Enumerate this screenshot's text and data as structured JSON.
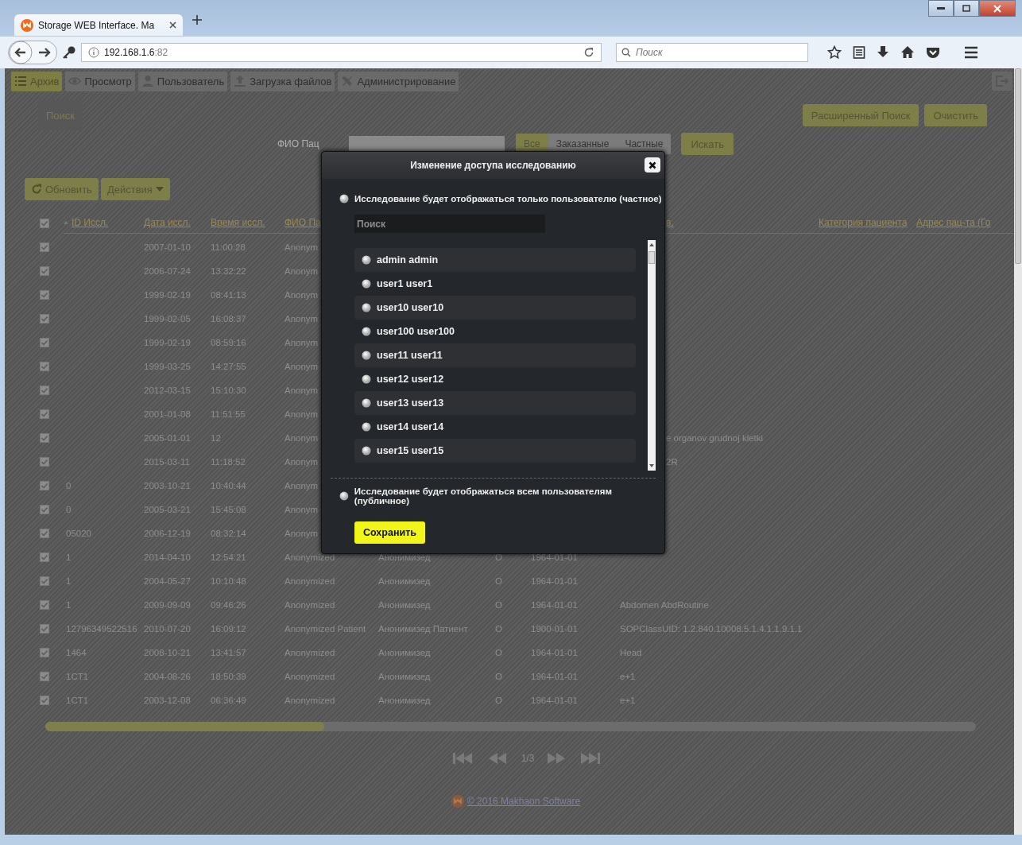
{
  "browser": {
    "tab_title": "Storage WEB Interface. Ma",
    "url_host": "192.168.1.6",
    "url_port": ":82",
    "search_placeholder": "Поиск"
  },
  "nav_tabs": [
    {
      "kind": "archive",
      "label": "Архив",
      "selected": true
    },
    {
      "kind": "view",
      "label": "Просмотр",
      "selected": false
    },
    {
      "kind": "user",
      "label": "Пользователь",
      "selected": false
    },
    {
      "kind": "upload",
      "label": "Загрузка файлов",
      "selected": false
    },
    {
      "kind": "admin",
      "label": "Администрирование",
      "selected": false
    }
  ],
  "search_panel": {
    "tab": "Поиск",
    "buttons": [
      "Расширенный Поиск",
      "Очистить"
    ],
    "filter_label": "ФИО Пац",
    "segments": [
      {
        "label": "Все",
        "selected": true
      },
      {
        "label": "Заказанные",
        "selected": false
      },
      {
        "label": "Частные",
        "selected": false
      }
    ],
    "search_button": "Искать"
  },
  "actions": {
    "refresh": "Обновить",
    "menu": "Действия"
  },
  "table": {
    "all_checked": true,
    "id_sort_ascending": true,
    "columns": {
      "id": "ID Иссл.",
      "date": "Дата иссл.",
      "time": "Время иссл.",
      "name": "ФИО Па",
      "description": "в.",
      "category": "Категория пациента",
      "address": "Адрес пац-та (Го"
    },
    "rows": [
      {
        "checked": true,
        "date": "2007-01-10",
        "time": "11:00:28",
        "name": "Anonym"
      },
      {
        "checked": true,
        "date": "2006-07-24",
        "time": "13:32:22",
        "name": "Anonym"
      },
      {
        "checked": true,
        "date": "1999-02-19",
        "time": "08:41:13",
        "name": "Anonym"
      },
      {
        "checked": true,
        "date": "1999-02-05",
        "time": "16:08:37",
        "name": "Anonym"
      },
      {
        "checked": true,
        "date": "1999-02-19",
        "time": "08:59:16",
        "name": "Anonym"
      },
      {
        "checked": true,
        "date": "1999-03-25",
        "time": "14:27:55",
        "name": "Anonym"
      },
      {
        "checked": true,
        "date": "2012-03-15",
        "time": "15:10:30",
        "name": "Anonym"
      },
      {
        "checked": true,
        "date": "2001-01-08",
        "time": "11:51:55",
        "name": "Anonym"
      },
      {
        "checked": true,
        "date": "2005-01-01",
        "time": "12",
        "name": "Anonym",
        "description": "e organov grudnoj kletki",
        "description_partly_hidden": true
      },
      {
        "checked": true,
        "date": "2015-03-11",
        "time": "11:18:52",
        "name": "Anonym",
        "description": "2R",
        "description_partly_hidden": true
      },
      {
        "checked": true,
        "id": "0",
        "date": "2003-10-21",
        "time": "10:40:44",
        "name": "Anonym"
      },
      {
        "checked": true,
        "id": "0",
        "date": "2005-03-21",
        "time": "15:45:08",
        "name": "Anonym"
      },
      {
        "checked": true,
        "id": "05020",
        "date": "2006-12-19",
        "time": "08:32:14",
        "name": "Anonym"
      },
      {
        "checked": true,
        "id": "1",
        "date": "2014-04-10",
        "time": "12:54:21",
        "name": "Anonymized",
        "name_ru": "Анонимизед",
        "sex": "O",
        "birth": "1964-01-01"
      },
      {
        "checked": true,
        "id": "1",
        "date": "2004-05-27",
        "time": "10:10:48",
        "name": "Anonymized",
        "name_ru": "Анонимизед",
        "sex": "O",
        "birth": "1964-01-01"
      },
      {
        "checked": true,
        "id": "1",
        "date": "2009-09-09",
        "time": "09:46:26",
        "name": "Anonymized",
        "name_ru": "Анонимизед",
        "sex": "O",
        "birth": "1964-01-01",
        "description": "Abdomen AbdRoutine"
      },
      {
        "checked": true,
        "id": "12796349522516",
        "date": "2010-07-20",
        "time": "16:09:12",
        "name": "Anonymized Patient",
        "name_ru": "Анонимизед Патиент",
        "sex": "O",
        "birth": "1900-01-01",
        "description": "SOPClassUID: 1.2.840.10008.5.1.4.1.1.9.1.1"
      },
      {
        "checked": true,
        "id": "1464",
        "date": "2008-10-21",
        "time": "13:41:57",
        "name": "Anonymized",
        "name_ru": "Анонимизед",
        "sex": "O",
        "birth": "1964-01-01",
        "description": "Head"
      },
      {
        "checked": true,
        "id": "1CT1",
        "date": "2004-08-26",
        "time": "18:50:39",
        "name": "Anonymized",
        "name_ru": "Анонимизед",
        "sex": "O",
        "birth": "1964-01-01",
        "description": "e+1"
      },
      {
        "checked": true,
        "id": "1CT1",
        "date": "2003-12-08",
        "time": "06:36:49",
        "name": "Anonymized",
        "name_ru": "Анонимизед",
        "sex": "O",
        "birth": "1964-01-01",
        "description": "e+1"
      }
    ]
  },
  "pagination": {
    "page": "1/3"
  },
  "footer": {
    "copyright": "© 2016 Makhaon Software"
  },
  "modal": {
    "title": "Изменение доступа исследованию",
    "options": [
      {
        "kind": "private",
        "label": "Исследование будет отображаться только пользователю (частное)",
        "selected": false
      },
      {
        "kind": "public",
        "label": "Исследование будет отображаться всем пользователям (публичное)",
        "selected": false
      }
    ],
    "search_placeholder": "Поиск",
    "users": [
      {
        "label": "admin admin",
        "selected": false
      },
      {
        "label": "user1 user1",
        "selected": false
      },
      {
        "label": "user10 user10",
        "selected": false
      },
      {
        "label": "user100 user100",
        "selected": false
      },
      {
        "label": "user11 user11",
        "selected": false
      },
      {
        "label": "user12 user12",
        "selected": false
      },
      {
        "label": "user13 user13",
        "selected": false
      },
      {
        "label": "user14 user14",
        "selected": false
      },
      {
        "label": "user15 user15",
        "selected": false
      }
    ],
    "save_button": "Сохранить"
  }
}
